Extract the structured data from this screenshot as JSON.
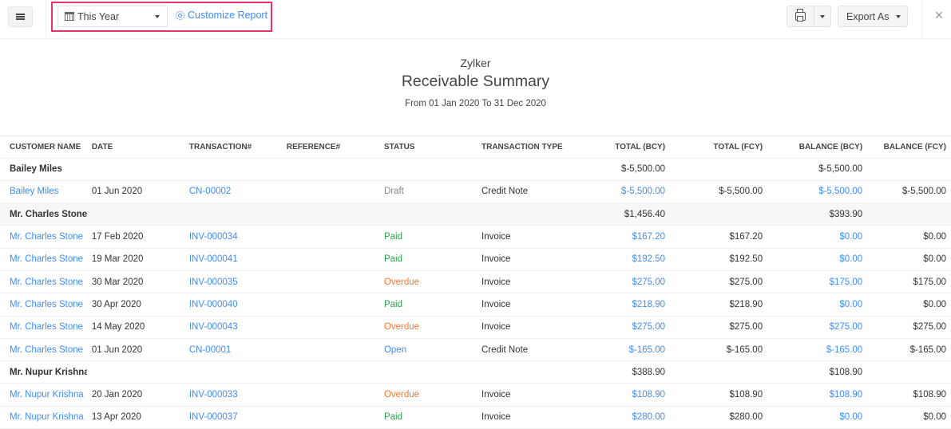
{
  "toolbar": {
    "menu_icon": "hamburger-icon",
    "period": {
      "icon": "calendar-icon",
      "label": "This Year"
    },
    "customize": {
      "icon": "gear-icon",
      "label": "Customize Report"
    },
    "print": {
      "icon": "printer-icon"
    },
    "export_label": "Export As",
    "close_icon": "×",
    "highlight_color": "#e8336b"
  },
  "report": {
    "organization": "Zylker",
    "title": "Receivable Summary",
    "range": "From 01 Jan 2020 To 31 Dec 2020"
  },
  "table": {
    "columns": [
      "CUSTOMER NAME",
      "DATE",
      "TRANSACTION#",
      "REFERENCE#",
      "STATUS",
      "TRANSACTION TYPE",
      "TOTAL (BCY)",
      "TOTAL (FCY)",
      "BALANCE (BCY)",
      "BALANCE (FCY)"
    ],
    "groups": [
      {
        "name": "Bailey Miles",
        "total_bcy": "$-5,500.00",
        "balance_bcy": "$-5,500.00",
        "rows": [
          {
            "customer": "Bailey Miles",
            "date": "01 Jun 2020",
            "txn": "CN-00002",
            "ref": "",
            "status": "Draft",
            "type": "Credit Note",
            "total_bcy": "$-5,500.00",
            "total_fcy": "$-5,500.00",
            "balance_bcy": "$-5,500.00",
            "balance_fcy": "$-5,500.00"
          }
        ]
      },
      {
        "name": "Mr. Charles Stone",
        "total_bcy": "$1,456.40",
        "balance_bcy": "$393.90",
        "rows": [
          {
            "customer": "Mr. Charles Stone",
            "date": "17 Feb 2020",
            "txn": "INV-000034",
            "ref": "",
            "status": "Paid",
            "type": "Invoice",
            "total_bcy": "$167.20",
            "total_fcy": "$167.20",
            "balance_bcy": "$0.00",
            "balance_fcy": "$0.00"
          },
          {
            "customer": "Mr. Charles Stone",
            "date": "19 Mar 2020",
            "txn": "INV-000041",
            "ref": "",
            "status": "Paid",
            "type": "Invoice",
            "total_bcy": "$192.50",
            "total_fcy": "$192.50",
            "balance_bcy": "$0.00",
            "balance_fcy": "$0.00"
          },
          {
            "customer": "Mr. Charles Stone",
            "date": "30 Mar 2020",
            "txn": "INV-000035",
            "ref": "",
            "status": "Overdue",
            "type": "Invoice",
            "total_bcy": "$275.00",
            "total_fcy": "$275.00",
            "balance_bcy": "$175.00",
            "balance_fcy": "$175.00"
          },
          {
            "customer": "Mr. Charles Stone",
            "date": "30 Apr 2020",
            "txn": "INV-000040",
            "ref": "",
            "status": "Paid",
            "type": "Invoice",
            "total_bcy": "$218.90",
            "total_fcy": "$218.90",
            "balance_bcy": "$0.00",
            "balance_fcy": "$0.00"
          },
          {
            "customer": "Mr. Charles Stone",
            "date": "14 May 2020",
            "txn": "INV-000043",
            "ref": "",
            "status": "Overdue",
            "type": "Invoice",
            "total_bcy": "$275.00",
            "total_fcy": "$275.00",
            "balance_bcy": "$275.00",
            "balance_fcy": "$275.00"
          },
          {
            "customer": "Mr. Charles Stone",
            "date": "01 Jun 2020",
            "txn": "CN-00001",
            "ref": "",
            "status": "Open",
            "type": "Credit Note",
            "total_bcy": "$-165.00",
            "total_fcy": "$-165.00",
            "balance_bcy": "$-165.00",
            "balance_fcy": "$-165.00"
          }
        ]
      },
      {
        "name": "Mr. Nupur Krishna",
        "total_bcy": "$388.90",
        "balance_bcy": "$108.90",
        "rows": [
          {
            "customer": "Mr. Nupur Krishna",
            "date": "20 Jan 2020",
            "txn": "INV-000033",
            "ref": "",
            "status": "Overdue",
            "type": "Invoice",
            "total_bcy": "$108.90",
            "total_fcy": "$108.90",
            "balance_bcy": "$108.90",
            "balance_fcy": "$108.90"
          },
          {
            "customer": "Mr. Nupur Krishna",
            "date": "13 Apr 2020",
            "txn": "INV-000037",
            "ref": "",
            "status": "Paid",
            "type": "Invoice",
            "total_bcy": "$280.00",
            "total_fcy": "$280.00",
            "balance_bcy": "$0.00",
            "balance_fcy": "$0.00"
          }
        ]
      }
    ]
  },
  "colors": {
    "link": "#408dfb",
    "paid": "#2ba44a",
    "overdue": "#f4782c",
    "open": "#408dfb",
    "draft": "#888888"
  }
}
